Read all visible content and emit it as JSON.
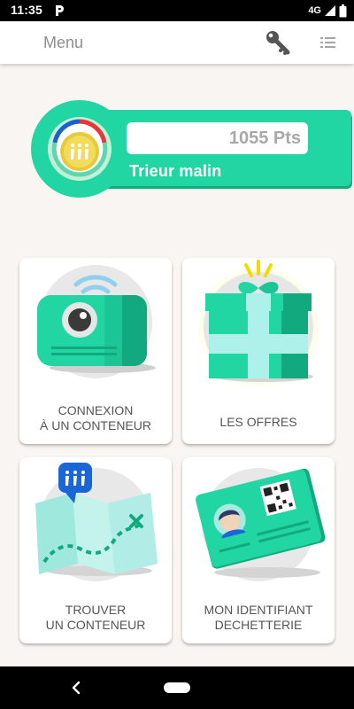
{
  "status_bar": {
    "time": "11:35",
    "network": "4G"
  },
  "app_bar": {
    "title": "Menu"
  },
  "score": {
    "points": "1055 Pts",
    "level": "Trieur malin"
  },
  "tiles": [
    {
      "line1": "CONNEXION",
      "line2": "À UN CONTENEUR"
    },
    {
      "line1": "LES OFFRES",
      "line2": ""
    },
    {
      "line1": "TROUVER",
      "line2": "UN CONTENEUR"
    },
    {
      "line1": "MON IDENTIFIANT",
      "line2": "DECHETTERIE"
    }
  ],
  "colors": {
    "accent": "#22d6a4",
    "accent_dark": "#13a97e",
    "badge_blue": "#1a66d6",
    "background": "#f8f5f2"
  },
  "icons": [
    "key-icon",
    "list-icon",
    "camera-icon",
    "gift-icon",
    "map-icon",
    "id-card-icon"
  ]
}
